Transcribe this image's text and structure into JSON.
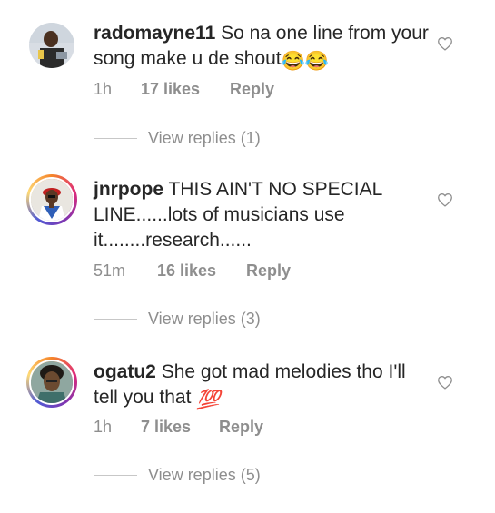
{
  "comments": [
    {
      "username": "radomayne11",
      "text": "So na one line from your song make u de shout",
      "emoji": "😂😂",
      "time": "1h",
      "likes": "17 likes",
      "reply": "Reply",
      "view_replies": "View replies (1)",
      "avatar_icon": "profile-photo"
    },
    {
      "username": "jnrpope",
      "text": "THIS AIN'T NO SPECIAL LINE......lots of musicians use it........research......",
      "time": "51m",
      "likes": "16 likes",
      "reply": "Reply",
      "view_replies": "View replies (3)",
      "avatar_icon": "profile-photo-story-ring"
    },
    {
      "username": "ogatu2",
      "text": "She got mad melodies tho I'll tell you that",
      "emoji": "💯",
      "time": "1h",
      "likes": "7 likes",
      "reply": "Reply",
      "view_replies": "View replies (5)",
      "avatar_icon": "profile-photo-story-ring"
    }
  ],
  "colors": {
    "text": "#262626",
    "meta": "#8e8e8e",
    "divider": "#c7c7c7",
    "story_ring": [
      "#f58529",
      "#dd2a7b",
      "#8134af",
      "#515bd4",
      "#feda77"
    ]
  },
  "icons": {
    "like": "heart-outline-icon"
  }
}
